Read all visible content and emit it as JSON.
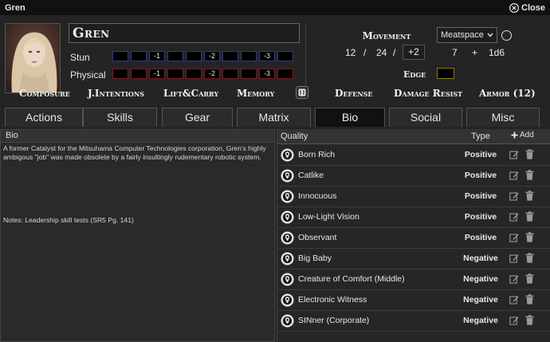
{
  "window": {
    "title": "Gren",
    "close_label": "Close"
  },
  "character": {
    "name": "Gren"
  },
  "condition": {
    "stun_label": "Stun",
    "physical_label": "Physical",
    "stun_boxes": [
      "",
      "",
      "-1",
      "",
      "",
      "-2",
      "",
      "",
      "-3",
      ""
    ],
    "physical_boxes": [
      "",
      "",
      "-1",
      "",
      "",
      "-2",
      "",
      "",
      "-3",
      ""
    ]
  },
  "movement": {
    "title": "Movement",
    "walk": "12",
    "sep1": "/",
    "run": "24",
    "sep2": "/",
    "bonus": "+2",
    "mode": "Meatspace",
    "initiative_base": "7",
    "initiative_plus": "+",
    "initiative_dice": "1d6"
  },
  "edge": {
    "label": "Edge"
  },
  "stats": [
    "Composure",
    "J.Intentions",
    "Lift&Carry",
    "Memory",
    "Defense",
    "Damage Resist",
    "Armor (12)"
  ],
  "tabs": [
    "Actions",
    "Skills",
    "Gear",
    "Matrix",
    "Bio",
    "Social",
    "Misc"
  ],
  "active_tab": "Bio",
  "bio": {
    "header": "Bio",
    "text": "A former Catalyst for the Mitsuhama Computer Technologies corporation, Gren's highly ambigous \"job\" was made obsolete by a fairly insultingly rudementary robotic system.",
    "notes": "Notes: Leadership skill tests (SR5 Pg. 141)"
  },
  "qualities": {
    "header_quality": "Quality",
    "header_type": "Type",
    "add_label": "Add",
    "rows": [
      {
        "name": "Born Rich",
        "type": "Positive"
      },
      {
        "name": "Catlike",
        "type": "Positive"
      },
      {
        "name": "Innocuous",
        "type": "Positive"
      },
      {
        "name": "Low-Light Vision",
        "type": "Positive"
      },
      {
        "name": "Observant",
        "type": "Positive"
      },
      {
        "name": "Big Baby",
        "type": "Negative"
      },
      {
        "name": "Creature of Comfort (Middle)",
        "type": "Negative"
      },
      {
        "name": "Electronic Witness",
        "type": "Negative"
      },
      {
        "name": "SINner (Corporate)",
        "type": "Negative"
      }
    ]
  },
  "colors": {
    "stun_border": "#2b3c8c",
    "physical_border": "#7a1d1d",
    "edge_border": "#8c7a1d"
  },
  "icons": [
    "close-icon",
    "chevron-down-icon",
    "dice-icon",
    "plus-icon",
    "quality-icon",
    "edit-icon",
    "trash-icon"
  ]
}
